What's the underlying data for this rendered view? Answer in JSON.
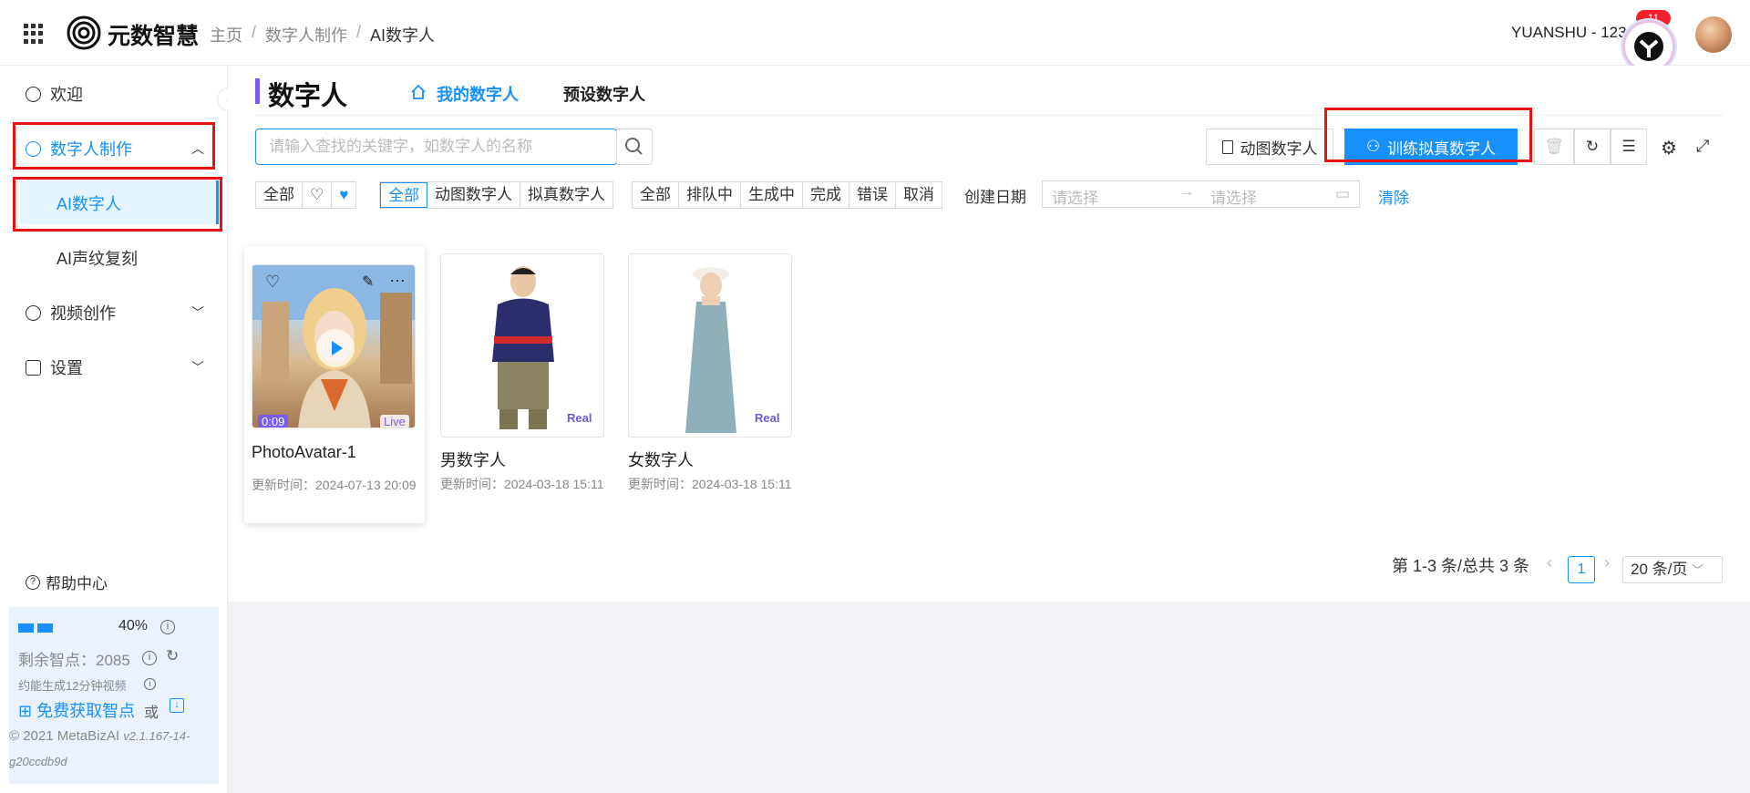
{
  "header": {
    "brand": "元数智慧",
    "breadcrumb": [
      "主页",
      "数字人制作",
      "AI数字人"
    ],
    "user_name": "YUANSHU - 123123",
    "badge": "11"
  },
  "sidebar": {
    "items": [
      {
        "label": "欢迎"
      },
      {
        "label": "数字人制作"
      },
      {
        "label": "AI数字人"
      },
      {
        "label": "AI声纹复刻"
      },
      {
        "label": "视频创作"
      },
      {
        "label": "设置"
      }
    ],
    "help": "帮助中心",
    "quota": {
      "percent": "40%",
      "remaining": "剩余智点：2085",
      "approx": "约能生成12分钟视频",
      "free": "免费获取智点",
      "or": "或"
    },
    "copyright": "© 2021 MetaBizAI",
    "version": "v2.1.167-14-g20ccdb9d"
  },
  "main": {
    "title": "数字人",
    "tabs": [
      {
        "label": "我的数字人"
      },
      {
        "label": "预设数字人"
      }
    ],
    "search": {
      "placeholder": "请输入查找的关键字，如数字人的名称"
    },
    "buttons": {
      "animated": "动图数字人",
      "train_real": "训练拟真数字人"
    },
    "filters": {
      "favorite": [
        "全部"
      ],
      "type": [
        "全部",
        "动图数字人",
        "拟真数字人"
      ],
      "status": [
        "全部",
        "排队中",
        "生成中",
        "完成",
        "错误",
        "取消"
      ],
      "date_label": "创建日期",
      "date_start_placeholder": "请选择",
      "date_end_placeholder": "请选择",
      "clear": "清除"
    },
    "cards": [
      {
        "name": "PhotoAvatar-1",
        "time_label": "更新时间：",
        "time": "2024-07-13 20:09",
        "duration": "0:09",
        "tag": "Live"
      },
      {
        "name": "男数字人",
        "time_label": "更新时间：",
        "time": "2024-03-18 15:11",
        "tag": "Real"
      },
      {
        "name": "女数字人",
        "time_label": "更新时间：",
        "time": "2024-03-18 15:11",
        "tag": "Real"
      }
    ],
    "pagination": {
      "summary": "第 1-3 条/总共 3 条",
      "current": "1",
      "page_size": "20 条/页"
    }
  },
  "colors": {
    "accent": "#1890ff",
    "highlight": "#e41414",
    "brand_purple": "#7a5cf0"
  }
}
